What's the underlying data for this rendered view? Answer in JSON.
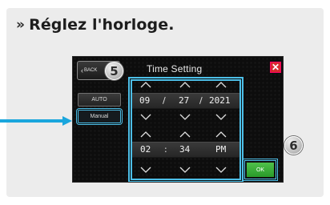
{
  "heading": {
    "marker": "»",
    "text": "Réglez l'horloge."
  },
  "screen": {
    "back_label": "BACK",
    "title": "Time Setting",
    "close_symbol": "✕",
    "mode_buttons": {
      "auto": "AUTO",
      "manual": "Manual"
    },
    "date": {
      "month": "09",
      "sep1": "/",
      "day": "27",
      "sep2": "/",
      "year": "2021"
    },
    "time": {
      "hour": "02",
      "sep": ":",
      "minute": "34",
      "ampm": "PM"
    },
    "ok_label": "OK"
  },
  "callouts": {
    "five": "5",
    "six": "6"
  },
  "colors": {
    "highlight": "#4dbfe8",
    "close_bg": "#d8292f",
    "ok_bg": "#3aad36",
    "pointer_arrow": "#1aa6dd"
  },
  "icons": [
    "chevron-up-icon",
    "chevron-down-icon",
    "back-chevron-icon",
    "close-icon",
    "pointer-arrow"
  ]
}
